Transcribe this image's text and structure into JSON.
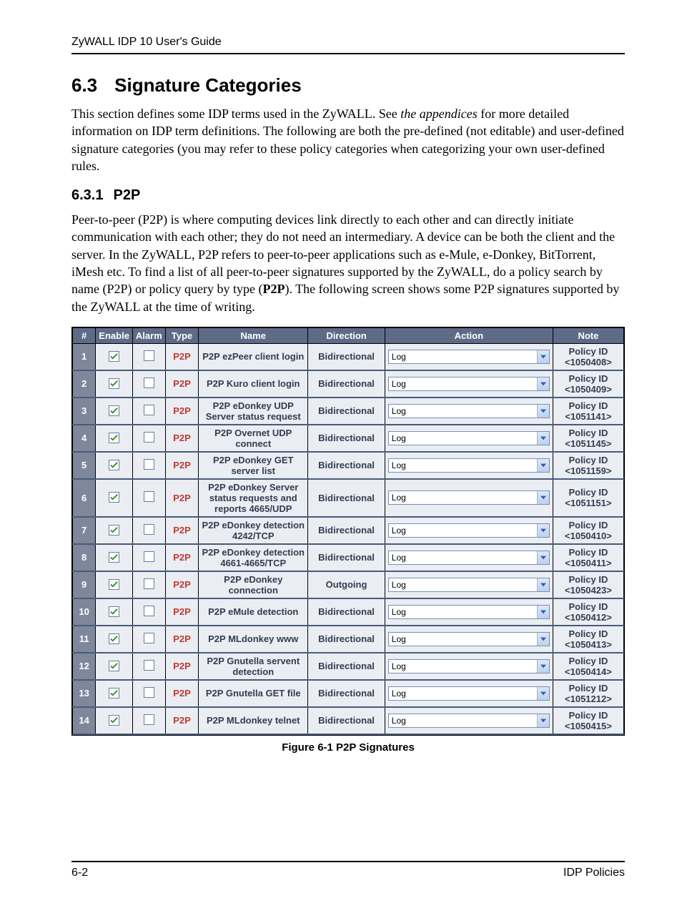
{
  "header": {
    "running_head": "ZyWALL IDP 10 User's Guide"
  },
  "section": {
    "number": "6.3",
    "title": "Signature Categories",
    "intro_before_em": "This section defines some IDP terms used in the ZyWALL. See ",
    "intro_em": "the appendices",
    "intro_after_em": " for more detailed information on IDP term definitions. The following are both the pre-defined (not editable) and user-defined signature categories (you may refer to these policy categories when categorizing your own user-defined rules."
  },
  "subsection": {
    "number": "6.3.1",
    "title": "P2P",
    "para_before_bold": "Peer-to-peer (P2P) is where computing devices link directly to each other and can directly initiate communication with each other; they do not need an intermediary. A device can be both the client and the server. In the ZyWALL, P2P refers to peer-to-peer applications such as e-Mule, e-Donkey, BitTorrent, iMesh etc. To find a list of all peer-to-peer signatures supported by the ZyWALL, do a policy search by name (P2P) or policy query by type (",
    "para_bold": "P2P",
    "para_after_bold": "). The following screen shows some P2P signatures supported by the ZyWALL at the time of writing."
  },
  "table": {
    "headers": {
      "num": "#",
      "enable": "Enable",
      "alarm": "Alarm",
      "type": "Type",
      "name": "Name",
      "direction": "Direction",
      "action": "Action",
      "note": "Note"
    },
    "type_label": "P2P",
    "action_value": "Log",
    "note_label": "Policy ID",
    "rows": [
      {
        "n": "1",
        "enable": true,
        "alarm": false,
        "name": "P2P ezPeer client login",
        "direction": "Bidirectional",
        "policy_id": "<1050408>"
      },
      {
        "n": "2",
        "enable": true,
        "alarm": false,
        "name": "P2P Kuro client login",
        "direction": "Bidirectional",
        "policy_id": "<1050409>"
      },
      {
        "n": "3",
        "enable": true,
        "alarm": false,
        "name": "P2P eDonkey UDP Server status request",
        "direction": "Bidirectional",
        "policy_id": "<1051141>"
      },
      {
        "n": "4",
        "enable": true,
        "alarm": false,
        "name": "P2P Overnet UDP connect",
        "direction": "Bidirectional",
        "policy_id": "<1051145>"
      },
      {
        "n": "5",
        "enable": true,
        "alarm": false,
        "name": "P2P eDonkey GET server list",
        "direction": "Bidirectional",
        "policy_id": "<1051159>"
      },
      {
        "n": "6",
        "enable": true,
        "alarm": false,
        "name": "P2P eDonkey Server status requests and reports 4665/UDP",
        "direction": "Bidirectional",
        "policy_id": "<1051151>"
      },
      {
        "n": "7",
        "enable": true,
        "alarm": false,
        "name": "P2P eDonkey detection 4242/TCP",
        "direction": "Bidirectional",
        "policy_id": "<1050410>"
      },
      {
        "n": "8",
        "enable": true,
        "alarm": false,
        "name": "P2P eDonkey detection 4661-4665/TCP",
        "direction": "Bidirectional",
        "policy_id": "<1050411>"
      },
      {
        "n": "9",
        "enable": true,
        "alarm": false,
        "name": "P2P eDonkey connection",
        "direction": "Outgoing",
        "policy_id": "<1050423>"
      },
      {
        "n": "10",
        "enable": true,
        "alarm": false,
        "name": "P2P eMule detection",
        "direction": "Bidirectional",
        "policy_id": "<1050412>"
      },
      {
        "n": "11",
        "enable": true,
        "alarm": false,
        "name": "P2P MLdonkey www",
        "direction": "Bidirectional",
        "policy_id": "<1050413>"
      },
      {
        "n": "12",
        "enable": true,
        "alarm": false,
        "name": "P2P Gnutella servent detection",
        "direction": "Bidirectional",
        "policy_id": "<1050414>"
      },
      {
        "n": "13",
        "enable": true,
        "alarm": false,
        "name": "P2P Gnutella GET file",
        "direction": "Bidirectional",
        "policy_id": "<1051212>"
      },
      {
        "n": "14",
        "enable": true,
        "alarm": false,
        "name": "P2P MLdonkey telnet",
        "direction": "Bidirectional",
        "policy_id": "<1050415>"
      }
    ]
  },
  "caption": "Figure 6-1 P2P Signatures",
  "footer": {
    "left": "6-2",
    "right": "IDP Policies"
  }
}
